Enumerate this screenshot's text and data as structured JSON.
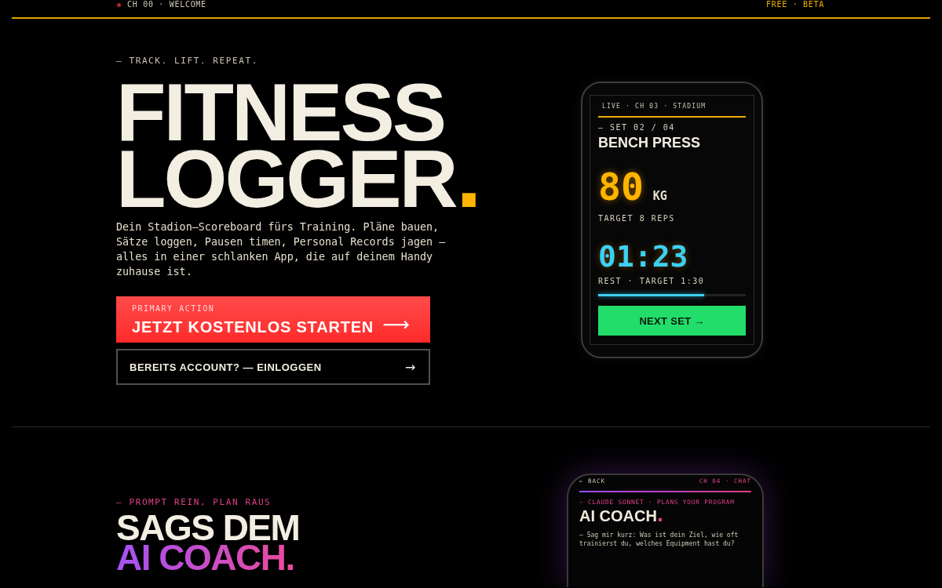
{
  "top_bar": {
    "channel": "CH 00 · WELCOME",
    "plan": "FREE · BETA"
  },
  "hero": {
    "tagline": "— TRACK. LIFT. REPEAT.",
    "title": {
      "lines": [
        "FITNESS",
        "LOGGER"
      ],
      "end_mark": "."
    },
    "description": "Dein Stadion—Scoreboard fürs Training. Pläne bauen, Sätze loggen, Pausen timen, Personal Records jagen — alles in einer schlanken App, die auf deinem Handy zuhause ist.",
    "primary_button": {
      "caption": "PRIMARY ACTION",
      "label": "JETZT KOSTENLOS STARTEN",
      "arrow": "⟶"
    },
    "secondary_button": {
      "label": "BEREITS ACCOUNT? — EINLOGGEN",
      "arrow": "→"
    }
  },
  "workout_phone": {
    "header": "LIVE · CH 03 · STADIUM",
    "set": "— SET 02 / 04",
    "exercise": "BENCH PRESS",
    "weight": "80",
    "unit": "KG",
    "target_reps": "TARGET 8 REPS",
    "timer": "01:23",
    "rest_info": "REST · TARGET 1:30",
    "rest_progress": {
      "level": 0.72
    },
    "next_button": "NEXT SET →"
  },
  "coach_section": {
    "tagline": "— PROMPT REIN, PLAN RAUS",
    "title": {
      "lines": [
        "SAGS DEM",
        "AI COACH"
      ],
      "end_mark": "."
    }
  },
  "coach_phone": {
    "back_link": "← BACK",
    "channel": "CH 04 · CHAT",
    "subtitle": "— CLAUDE SONNET · PLANS YOUR PROGRAM",
    "title": {
      "text": "AI COACH",
      "end_mark": "."
    },
    "message": "— Sag mir kurz: Was ist dein Ziel, wie oft trainierst du, welches Equipment hast du?"
  }
}
